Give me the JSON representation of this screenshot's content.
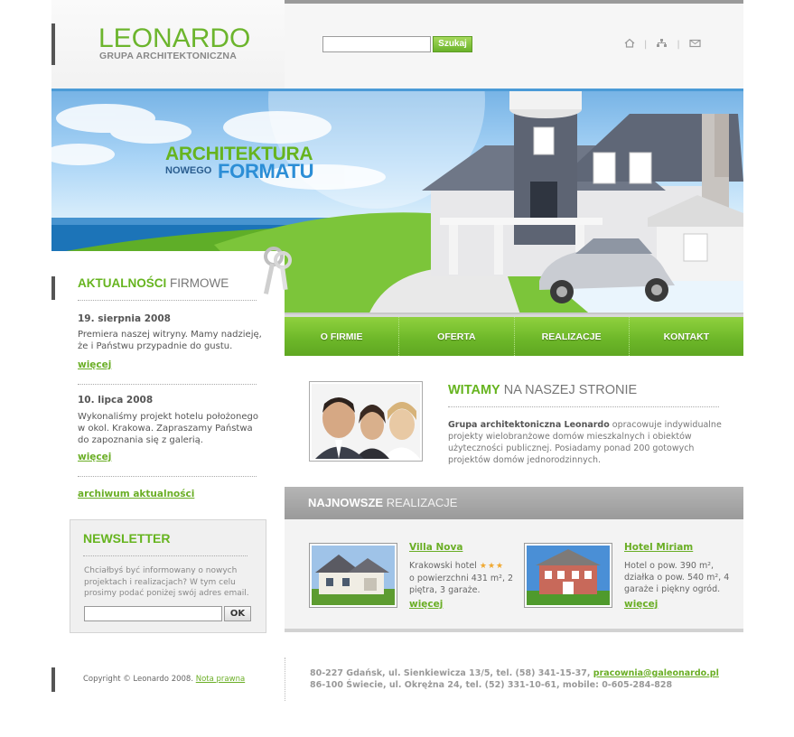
{
  "header": {
    "logo_title": "LEONARDO",
    "logo_subtitle": "GRUPA ARCHITEKTONICZNA",
    "search_placeholder": "",
    "search_button": "Szukaj",
    "icons": [
      "home-icon",
      "sitemap-icon",
      "mail-icon"
    ]
  },
  "banner": {
    "line1": "ARCHITEKTURA",
    "line2": "NOWEGO",
    "line3": "FORMATU"
  },
  "nav": {
    "items": [
      "O FIRMIE",
      "OFERTA",
      "REALIZACJE",
      "KONTAKT"
    ]
  },
  "news": {
    "title_strong": "AKTUALNOŚCI",
    "title_rest": "FIRMOWE",
    "items": [
      {
        "date": "19. sierpnia 2008",
        "text": "Premiera naszej witryny. Mamy nadzieję, że i Państwu przypadnie do gustu.",
        "more": "więcej"
      },
      {
        "date": "10. lipca 2008",
        "text": "Wykonaliśmy projekt hotelu położonego w okol. Krakowa. Zapraszamy Państwa do zapoznania się z galerią.",
        "more": "więcej"
      }
    ],
    "archive": "archiwum aktualności"
  },
  "newsletter": {
    "title": "NEWSLETTER",
    "text": "Chciałbyś być informowany o nowych projektach i realizacjach? W tym celu prosimy podać poniżej swój adres email.",
    "ok": "OK"
  },
  "welcome": {
    "title_strong": "WITAMY",
    "title_rest": "NA NASZEJ STRONIE",
    "text_strong": "Grupa architektoniczna Leonardo",
    "text_rest": " opracowuje indywidualne projekty wielobranżowe domów mieszkalnych i obiektów użyteczności publicznej. Posiadamy ponad 200 gotowych projektów domów jednorodzinnych."
  },
  "latest": {
    "title_strong": "NAJNOWSZE",
    "title_rest": "REALIZACJE",
    "projects": [
      {
        "name": "Villa Nova",
        "text": "Krakowski hotel",
        "rating": 3,
        "details": "o powierzchni 431 m², 2 piętra, 3 garaże.",
        "more": "więcej"
      },
      {
        "name": "Hotel Miriam",
        "text": "Hotel o pow. 390 m², działka o pow. 540 m², 4 garaże i piękny ogród.",
        "more": "więcej"
      }
    ]
  },
  "footer": {
    "copyright": "Copyright © Leonardo 2008.",
    "legal_link": "Nota prawna",
    "address1": "80-227 Gdańsk, ul. Sienkiewicza 13/5, tel. (58) 341-15-37,",
    "email": "pracownia@galeonardo.pl",
    "address2": "86-100 Świecie, ul. Okrężna 24, tel. (52) 331-10-61, mobile: 0-605-284-828"
  },
  "colors": {
    "brand_green": "#66b41f",
    "link_green": "#6aae25",
    "accent_blue": "#2c8ed6",
    "dark_bar": "#555555",
    "gray_header": "#9a9a9a"
  }
}
